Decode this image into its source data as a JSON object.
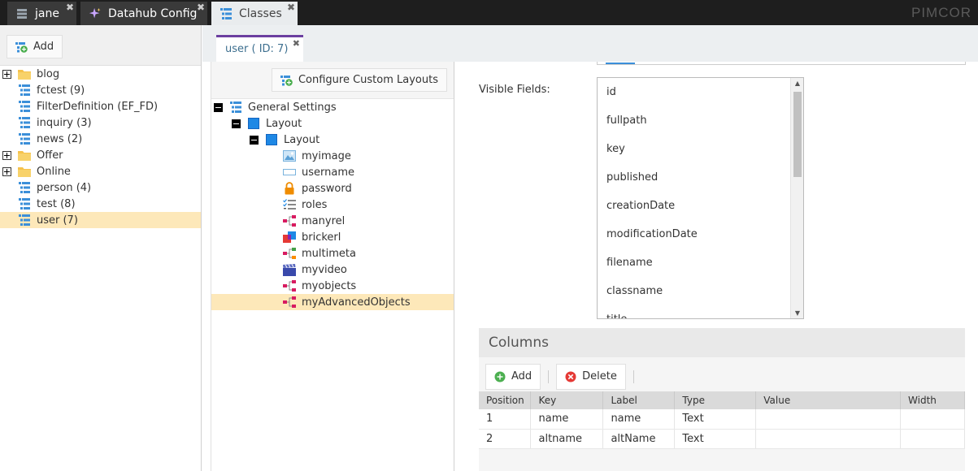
{
  "top_tabs": [
    {
      "label": "jane",
      "icon": "user-list-icon",
      "active": false
    },
    {
      "label": "Datahub Config",
      "icon": "sparkle-icon",
      "active": false
    },
    {
      "label": "Classes",
      "icon": "class-icon",
      "active": true
    }
  ],
  "brand": "PIMCOR",
  "left": {
    "add_label": "Add",
    "tree": [
      {
        "label": "blog",
        "type": "folder",
        "expand": "plus"
      },
      {
        "label": "fctest (9)",
        "type": "class"
      },
      {
        "label": "FilterDefinition (EF_FD)",
        "type": "class"
      },
      {
        "label": "inquiry (3)",
        "type": "class"
      },
      {
        "label": "news (2)",
        "type": "class"
      },
      {
        "label": "Offer",
        "type": "folder",
        "expand": "plus"
      },
      {
        "label": "Online",
        "type": "folder",
        "expand": "plus"
      },
      {
        "label": "person (4)",
        "type": "class"
      },
      {
        "label": "test (8)",
        "type": "class"
      },
      {
        "label": "user (7)",
        "type": "class",
        "selected": true
      }
    ]
  },
  "main_tab": {
    "label": "user ( ID: 7)"
  },
  "middle": {
    "configure_label": "Configure Custom Layouts",
    "tree": [
      {
        "label": "General Settings",
        "level": 0,
        "expand": "minus",
        "icon": "class"
      },
      {
        "label": "Layout",
        "level": 1,
        "expand": "minus",
        "icon": "layout"
      },
      {
        "label": "Layout",
        "level": 2,
        "expand": "minus",
        "icon": "layout"
      },
      {
        "label": "myimage",
        "level": 3,
        "icon": "image"
      },
      {
        "label": "username",
        "level": 3,
        "icon": "input"
      },
      {
        "label": "password",
        "level": 3,
        "icon": "lock"
      },
      {
        "label": "roles",
        "level": 3,
        "icon": "multiselect"
      },
      {
        "label": "manyrel",
        "level": 3,
        "icon": "relation"
      },
      {
        "label": "brickerl",
        "level": 3,
        "icon": "brick"
      },
      {
        "label": "multimeta",
        "level": 3,
        "icon": "relation-meta"
      },
      {
        "label": "myvideo",
        "level": 3,
        "icon": "video"
      },
      {
        "label": "myobjects",
        "level": 3,
        "icon": "objects"
      },
      {
        "label": "myAdvancedObjects",
        "level": 3,
        "icon": "objects",
        "selected": true
      }
    ]
  },
  "right": {
    "visible_fields_label": "Visible Fields:",
    "visible_fields": [
      "id",
      "fullpath",
      "key",
      "published",
      "creationDate",
      "modificationDate",
      "filename",
      "classname",
      "title"
    ],
    "columns_title": "Columns",
    "add_label": "Add",
    "delete_label": "Delete",
    "table": {
      "headers": [
        "Position",
        "Key",
        "Label",
        "Type",
        "Value",
        "Width"
      ],
      "rows": [
        [
          "1",
          "name",
          "name",
          "Text",
          "",
          ""
        ],
        [
          "2",
          "altname",
          "altName",
          "Text",
          "",
          ""
        ]
      ]
    }
  },
  "colors": {
    "accent": "#6b3fa0",
    "selection": "#fde8b9",
    "class_icon": "#3b8fd9",
    "folder": "#f5c24c"
  }
}
